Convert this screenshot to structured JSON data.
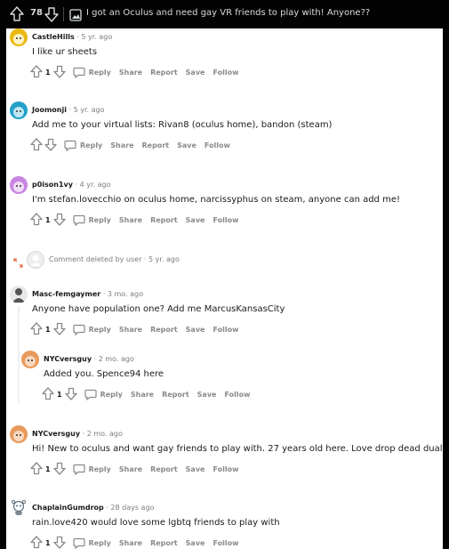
{
  "topbar": {
    "vote_count": "78",
    "title": "I got an Oculus and need gay VR friends to play with! Anyone??"
  },
  "labels": {
    "reply": "Reply",
    "share": "Share",
    "report": "Report",
    "save": "Save",
    "follow": "Follow"
  },
  "comments": [
    {
      "user": "CastleHills",
      "time": "· 5 yr. ago",
      "text": "I like ur sheets",
      "votes": "1",
      "avatar_color": "#e8b910"
    },
    {
      "user": "Joomonji",
      "time": "· 5 yr. ago",
      "text": "Add me to your virtual lists: Rivan8 (oculus home), bandon (steam)",
      "votes": "",
      "avatar_color": "#24a0c9"
    },
    {
      "user": "p0ison1vy",
      "time": "· 4 yr. ago",
      "text": "I'm stefan.lovecchio on oculus home, narcissyphus on steam, anyone can add me!",
      "votes": "1",
      "avatar_color": "#c785e0"
    },
    {
      "deleted_text": "Comment deleted by user",
      "time": "· 5 yr. ago"
    },
    {
      "user": "Masc-femgaymer",
      "time": "· 3 mo. ago",
      "text": "Anyone have population one? Add me MarcusKansasCity",
      "votes": "1",
      "avatar_color": "#555555"
    },
    {
      "user": "NYCversguy",
      "time": "· 2 mo. ago",
      "text": "Added you. Spence94 here",
      "votes": "1",
      "avatar_color": "#e89a5c"
    },
    {
      "user": "NYCversguy",
      "time": "· 2 mo. ago",
      "text": "Hi! New to oculus and want gay friends to play with. 27 years old here. Love drop dead dual strike",
      "votes": "1",
      "avatar_color": "#e89a5c"
    },
    {
      "user": "ChaplainGumdrop",
      "time": "· 28 days ago",
      "text": "rain.love420 would love some lgbtq friends to play with",
      "votes": "1",
      "avatar_color": "#5f6e7a"
    }
  ]
}
